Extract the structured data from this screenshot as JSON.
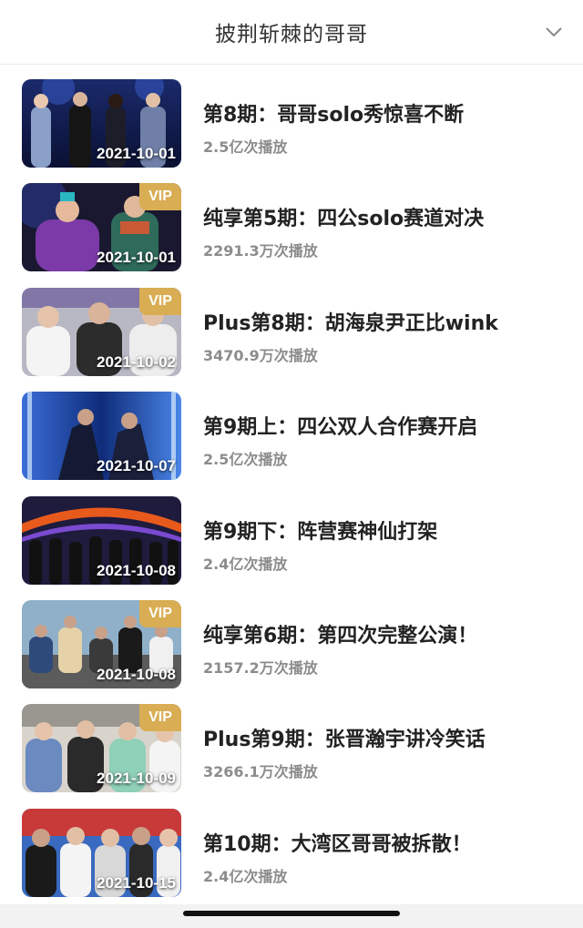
{
  "header": {
    "title": "披荆斩棘的哥哥",
    "chevron_icon": "chevron-down-icon"
  },
  "episodes": [
    {
      "title": "第8期：哥哥solo秀惊喜不断",
      "views": "2.5亿次播放",
      "date": "2021-10-01",
      "vip": false,
      "vip_label": ""
    },
    {
      "title": "纯享第5期：四公solo赛道对决",
      "views": "2291.3万次播放",
      "date": "2021-10-01",
      "vip": true,
      "vip_label": "VIP"
    },
    {
      "title": "Plus第8期：胡海泉尹正比wink",
      "views": "3470.9万次播放",
      "date": "2021-10-02",
      "vip": true,
      "vip_label": "VIP"
    },
    {
      "title": "第9期上：四公双人合作赛开启",
      "views": "2.5亿次播放",
      "date": "2021-10-07",
      "vip": false,
      "vip_label": ""
    },
    {
      "title": "第9期下：阵营赛神仙打架",
      "views": "2.4亿次播放",
      "date": "2021-10-08",
      "vip": false,
      "vip_label": ""
    },
    {
      "title": "纯享第6期：第四次完整公演！",
      "views": "2157.2万次播放",
      "date": "2021-10-08",
      "vip": true,
      "vip_label": "VIP"
    },
    {
      "title": "Plus第9期：张晋瀚宇讲冷笑话",
      "views": "3266.1万次播放",
      "date": "2021-10-09",
      "vip": true,
      "vip_label": "VIP"
    },
    {
      "title": "第10期：大湾区哥哥被拆散！",
      "views": "2.4亿次播放",
      "date": "2021-10-15",
      "vip": false,
      "vip_label": ""
    }
  ],
  "colors": {
    "vip_badge": "#d8ad53",
    "title_text": "#222222",
    "views_text": "#8c8c8c"
  }
}
